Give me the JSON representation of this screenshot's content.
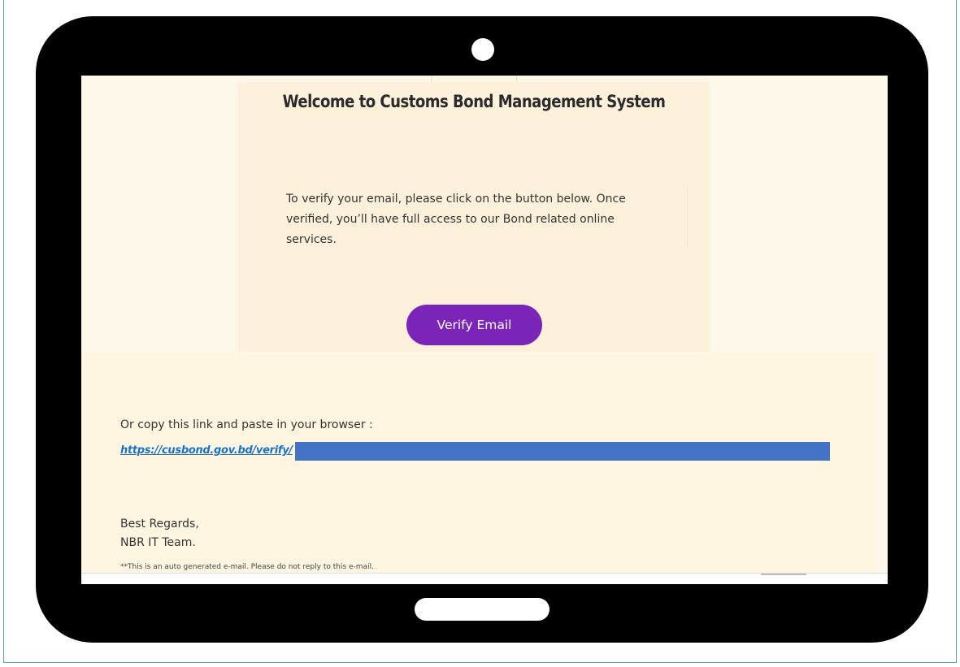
{
  "email": {
    "title": "Welcome to Customs Bond Management System",
    "intro_line1": "To verify your email, please click on the button below. Once",
    "intro_line2": "verified, you’ll have full access to our Bond related online",
    "intro_line3": "services.",
    "verify_button_label": "Verify Email",
    "copy_link_label": "Or copy this link and paste in your browser :",
    "verify_link_text": "https://cusbond.gov.bd/verify/",
    "signoff_line1": "Best Regards,",
    "signoff_line2": "NBR IT Team.",
    "disclaimer": "**This is an auto generated e-mail. Please do not reply to this e-mail."
  },
  "colors": {
    "button": "#7a24b8",
    "link": "#1a73c7",
    "redaction": "#4472c4",
    "tablet_frame": "#000000",
    "background": "#fdf8ea"
  }
}
